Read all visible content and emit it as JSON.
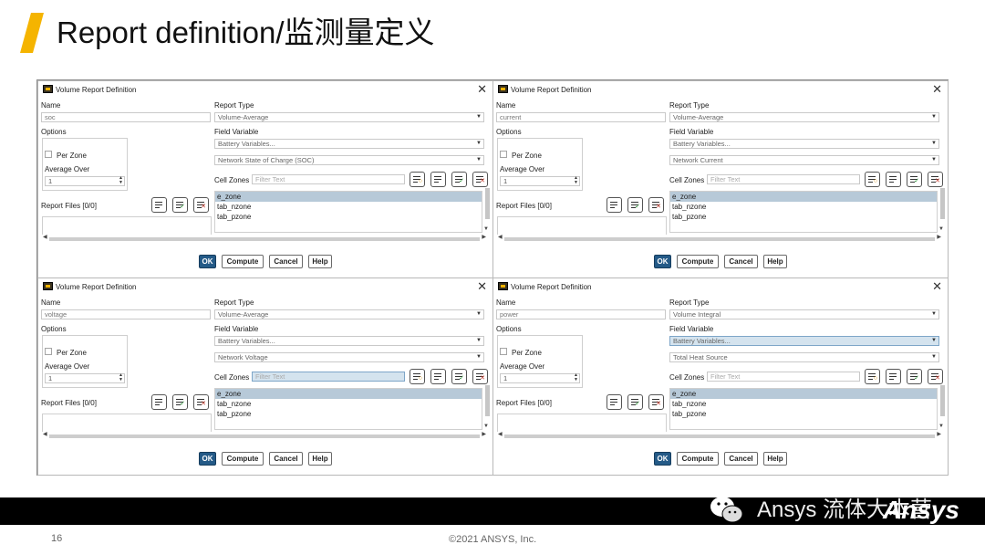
{
  "slide": {
    "title": "Report definition/监测量定义",
    "page_number": "16",
    "copyright": "©2021 ANSYS, Inc.",
    "brand": "Ansys",
    "watermark": "Ansys 流体大本营",
    "accent_color": "#f5b400"
  },
  "common": {
    "window_title": "Volume Report Definition",
    "name_label": "Name",
    "options_label": "Options",
    "per_zone_label": "Per Zone",
    "average_over_label": "Average Over",
    "average_over_value": "1",
    "report_files_label": "Report Files [0/0]",
    "report_type_label": "Report Type",
    "field_variable_label": "Field Variable",
    "cell_zones_label": "Cell Zones",
    "filter_placeholder": "Filter Text",
    "zones": [
      "e_zone",
      "tab_nzone",
      "tab_pzone"
    ],
    "ok": "OK",
    "compute": "Compute",
    "cancel": "Cancel",
    "help": "Help"
  },
  "dialogs": [
    {
      "name": "soc",
      "report_type": "Volume-Average",
      "field_category": "Battery Variables...",
      "field_variable": "Network State of Charge (SOC)"
    },
    {
      "name": "current",
      "report_type": "Volume-Average",
      "field_category": "Battery Variables...",
      "field_variable": "Network Current"
    },
    {
      "name": "voltage",
      "report_type": "Volume-Average",
      "field_category": "Battery Variables...",
      "field_variable": "Network Voltage"
    },
    {
      "name": "power",
      "report_type": "Volume Integral",
      "field_category": "Battery Variables...",
      "field_variable": "Total Heat Source"
    }
  ]
}
